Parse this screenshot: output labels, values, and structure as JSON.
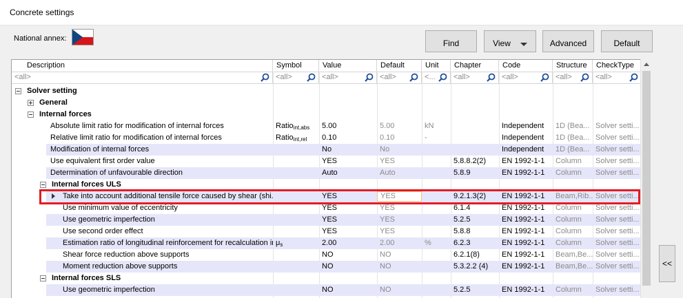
{
  "window": {
    "title": "Concrete settings"
  },
  "national_annex": {
    "label": "National annex:",
    "flag": "czech-flag"
  },
  "toolbar": {
    "find": "Find",
    "view": "View",
    "advanced": "Advanced",
    "default": "Default"
  },
  "columns": [
    "Description",
    "Symbol",
    "Value",
    "Default",
    "Unit",
    "Chapter",
    "Code",
    "Structure",
    "CheckType"
  ],
  "filters": [
    "<all>",
    "<all>",
    "<all>",
    "<all>",
    "<...",
    "<all>",
    "<all>",
    "<all>",
    "<all>"
  ],
  "rows": [
    {
      "description": "Solver setting",
      "group": true,
      "expanded": true,
      "level": 0
    },
    {
      "description": "General",
      "group": true,
      "expanded": false,
      "level": 1
    },
    {
      "description": "Internal forces",
      "group": true,
      "expanded": true,
      "level": 1
    },
    {
      "description": "Absolute limit ratio for modification of internal forces",
      "symbol": "Ratio",
      "symbol_sub": "int,abs",
      "value": "5.00",
      "default": "5.00",
      "unit": "kN",
      "chapter": "",
      "code": "Independent",
      "structure": "1D (Bea...",
      "checktype": "Solver setti...",
      "level": 2
    },
    {
      "description": "Relative limit ratio for modification of internal forces",
      "symbol": "Ratio",
      "symbol_sub": "int,rel",
      "value": "0.10",
      "default": "0.10",
      "unit": "-",
      "chapter": "",
      "code": "Independent",
      "structure": "1D (Bea...",
      "checktype": "Solver setti...",
      "level": 2
    },
    {
      "description": "Modification of internal forces",
      "symbol": "",
      "value": "No",
      "default": "No",
      "unit": "",
      "chapter": "",
      "code": "Independent",
      "structure": "1D (Bea...",
      "checktype": "Solver setti...",
      "level": 2,
      "shade": true
    },
    {
      "description": "Use equivalent first order value",
      "symbol": "",
      "value": "YES",
      "default": "YES",
      "unit": "",
      "chapter": "5.8.8.2(2)",
      "code": "EN 1992-1-1",
      "structure": "Column",
      "checktype": "Solver setti...",
      "level": 2
    },
    {
      "description": "Determination of unfavourable direction",
      "symbol": "",
      "value": "Auto",
      "default": "Auto",
      "unit": "",
      "chapter": "5.8.9",
      "code": "EN 1992-1-1",
      "structure": "Column",
      "checktype": "Solver setti...",
      "level": 2,
      "shade": true
    },
    {
      "description": "Internal forces ULS",
      "group": true,
      "expanded": true,
      "level": 2
    },
    {
      "description": "Take into account additional tensile force caused by shear (shi...",
      "symbol": "",
      "value": "YES",
      "default": "YES",
      "unit": "",
      "chapter": "9.2.1.3(2)",
      "code": "EN 1992-1-1",
      "structure": "Beam,Rib...",
      "checktype": "Solver setti...",
      "level": 3,
      "shade": true,
      "selected": true
    },
    {
      "description": "Use minimum value of eccentricity",
      "symbol": "",
      "value": "YES",
      "default": "YES",
      "unit": "",
      "chapter": "6.1.4",
      "code": "EN 1992-1-1",
      "structure": "Column",
      "checktype": "Solver setti...",
      "level": 3
    },
    {
      "description": "Use geometric imperfection",
      "symbol": "",
      "value": "YES",
      "default": "YES",
      "unit": "",
      "chapter": "5.2.5",
      "code": "EN 1992-1-1",
      "structure": "Column",
      "checktype": "Solver setti...",
      "level": 3,
      "shade": true
    },
    {
      "description": "Use second order effect",
      "symbol": "",
      "value": "YES",
      "default": "YES",
      "unit": "",
      "chapter": "5.8.8",
      "code": "EN 1992-1-1",
      "structure": "Column",
      "checktype": "Solver setti...",
      "level": 3
    },
    {
      "description": "Estimation ratio of longitudinal reinforcement for recalculation in...",
      "symbol": "μ",
      "symbol_sub": "s",
      "value": "2.00",
      "default": "2.00",
      "unit": "%",
      "chapter": "6.2.3",
      "code": "EN 1992-1-1",
      "structure": "Column",
      "checktype": "Solver setti...",
      "level": 3,
      "shade": true
    },
    {
      "description": "Shear force reduction above supports",
      "symbol": "",
      "value": "NO",
      "default": "NO",
      "unit": "",
      "chapter": "6.2.1(8)",
      "code": "EN 1992-1-1",
      "structure": "Beam,Be...",
      "checktype": "Solver setti...",
      "level": 3
    },
    {
      "description": "Moment reduction above supports",
      "symbol": "",
      "value": "NO",
      "default": "NO",
      "unit": "",
      "chapter": "5.3.2.2 (4)",
      "code": "EN 1992-1-1",
      "structure": "Beam,Be...",
      "checktype": "Solver setti...",
      "level": 3,
      "shade": true
    },
    {
      "description": "Internal forces SLS",
      "group": true,
      "expanded": true,
      "level": 2
    },
    {
      "description": "Use geometric imperfection",
      "symbol": "",
      "value": "NO",
      "default": "NO",
      "unit": "",
      "chapter": "5.2.5",
      "code": "EN 1992-1-1",
      "structure": "Column",
      "checktype": "Solver setti...",
      "level": 3,
      "shade": true
    }
  ],
  "collapse_panel": {
    "label": "<<"
  }
}
